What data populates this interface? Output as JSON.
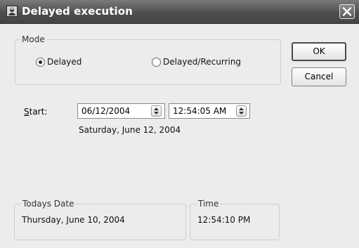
{
  "window": {
    "title": "Delayed execution",
    "app_icon": "app-icon",
    "close_icon": "close-icon"
  },
  "mode": {
    "legend": "Mode",
    "options": [
      {
        "label": "Delayed",
        "selected": true
      },
      {
        "label": "Delayed/Recurring",
        "selected": false
      }
    ]
  },
  "buttons": {
    "ok": "OK",
    "cancel": "Cancel"
  },
  "start": {
    "label_accel": "S",
    "label_rest": "tart:",
    "date_value": "06/12/2004",
    "time_value": "12:54:05 AM",
    "description": "Saturday, June 12, 2004",
    "spinner_icon": "spinner-arrows-icon"
  },
  "todays_date": {
    "legend": "Todays Date",
    "value": "Thursday, June 10, 2004"
  },
  "time": {
    "legend": "Time",
    "value": "12:54:10 PM"
  },
  "colors": {
    "titlebar_top": "#7a7a7a",
    "titlebar_bottom": "#444444",
    "dialog_background": "#ececec",
    "groupbox_border": "#cfcfcf"
  }
}
